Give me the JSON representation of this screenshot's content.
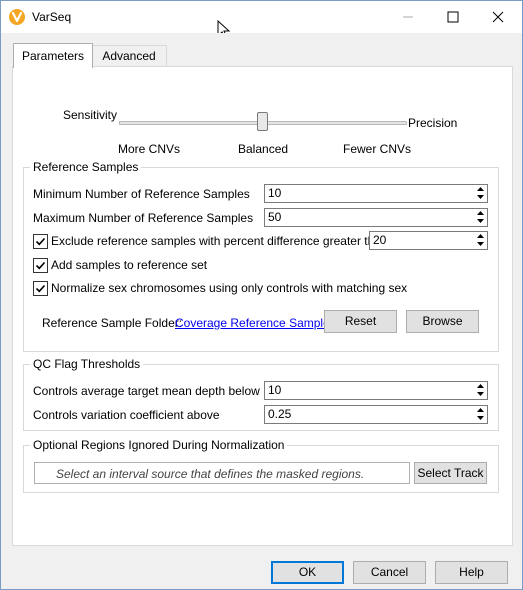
{
  "window": {
    "title": "VarSeq",
    "accent_color": "#f5a623"
  },
  "tabs": [
    {
      "label": "Parameters",
      "active": true
    },
    {
      "label": "Advanced",
      "active": false
    }
  ],
  "sensitivity": {
    "left_label": "Sensitivity",
    "right_label": "Precision",
    "tick_left": "More CNVs",
    "tick_mid": "Balanced",
    "tick_right": "Fewer CNVs",
    "value_fraction": 0.5
  },
  "reference_samples": {
    "title": "Reference Samples",
    "min_label": "Minimum Number of Reference Samples",
    "min_value": "10",
    "max_label": "Maximum Number of Reference Samples",
    "max_value": "50",
    "exclude_label": "Exclude reference samples with percent difference greater than",
    "exclude_value": "20",
    "exclude_checked": true,
    "add_label": "Add samples to reference set",
    "add_checked": true,
    "normalize_label": "Normalize sex chromosomes using only controls with matching sex",
    "normalize_checked": true,
    "folder_label": "Reference Sample Folder:",
    "folder_link": "Coverage Reference Samples",
    "reset_label": "Reset",
    "browse_label": "Browse"
  },
  "qc": {
    "title": "QC Flag Thresholds",
    "depth_label": "Controls average target mean depth below",
    "depth_value": "10",
    "variation_label": "Controls variation coefficient above",
    "variation_value": "0.25"
  },
  "regions": {
    "title": "Optional Regions Ignored During Normalization",
    "placeholder": "Select an interval source that defines the masked regions.",
    "select_track_label": "Select Track"
  },
  "footer": {
    "ok_label": "OK",
    "cancel_label": "Cancel",
    "help_label": "Help"
  }
}
